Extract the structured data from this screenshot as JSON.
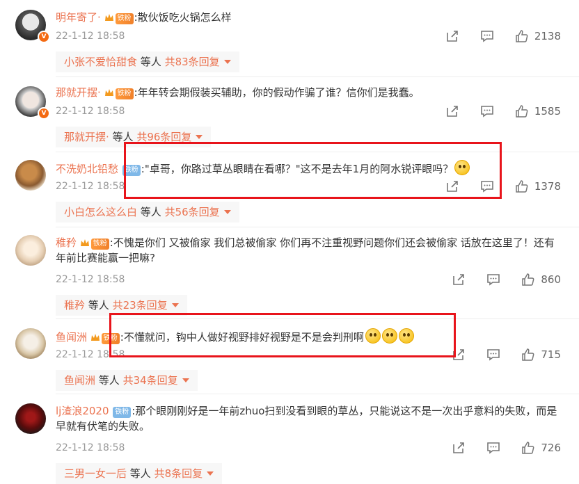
{
  "comments": [
    {
      "username": "明年寄了·",
      "badge": "铁粉",
      "text": ":散伙饭吃火锅怎么样",
      "time": "22-1-12 18:58",
      "likes": "2138",
      "reply_name": "小张不爱恰甜食",
      "reply_mid": " 等人 ",
      "reply_total": "共83条回复"
    },
    {
      "username": "那就开摆·",
      "badge": "铁粉",
      "text": ":年年转会期假装买辅助，你的假动作骗了谁？信你们是我蠢。",
      "time": "22-1-12 18:58",
      "likes": "1585",
      "reply_name": "那就开摆·",
      "reply_mid": " 等人 ",
      "reply_total": "共96条回复"
    },
    {
      "username": "不洗奶北铅愁",
      "badge": "铁粉",
      "text": ":\"卓哥，你路过草丛眼睛在看哪？\"这不是去年1月的阿水锐评眼吗？",
      "time": "22-1-12 18:58",
      "likes": "1378",
      "reply_name": "小白怎么这么白",
      "reply_mid": " 等人 ",
      "reply_total": "共56条回复"
    },
    {
      "username": "稚矜",
      "badge": "铁粉",
      "text": ":不愧是你们 又被偷家 我们总被偷家 你们再不注重视野问题你们还会被偷家 话放在这里了！还有 年前比赛能赢一把嘛?",
      "time": "22-1-12 18:58",
      "likes": "860",
      "reply_name": "稚矜",
      "reply_mid": " 等人 ",
      "reply_total": "共23条回复"
    },
    {
      "username": "鱼闻洲",
      "badge": "铁粉",
      "text": ":不懂就问，钩中人做好视野排好视野是不是会判刑啊",
      "time": "22-1-12 18:58",
      "likes": "715",
      "reply_name": "鱼闻洲",
      "reply_mid": " 等人 ",
      "reply_total": "共34条回复"
    },
    {
      "username": "lj渣浪2020",
      "badge": "铁粉",
      "text": ":那个眼刚刚好是一年前zhuo扫到没看到眼的草丛，只能说这不是一次出乎意料的失败，而是早就有伏笔的失败。",
      "time": "22-1-12 18:58",
      "likes": "726",
      "reply_name": "三男一女一后",
      "reply_mid": " 等人 ",
      "reply_total": "共8条回复"
    }
  ],
  "colors": {
    "username": "#eb7350",
    "highlight_box": "#e8141b"
  },
  "icons": [
    "share-icon",
    "comment-icon",
    "like-icon"
  ]
}
